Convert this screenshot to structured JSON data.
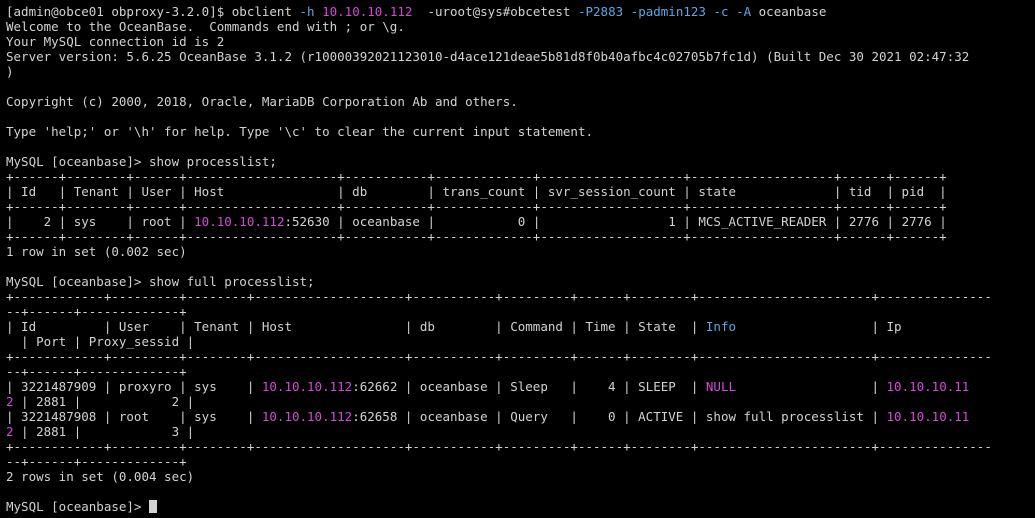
{
  "terminal": {
    "colors": {
      "background": "#000000",
      "default": "#d2d2d2",
      "accent": "#5aa7e6",
      "magenta": "#d24bd6"
    },
    "lines": [
      [
        {
          "t": "[admin@obce01 obproxy-3.2.0]$ obclient "
        },
        {
          "t": "-h",
          "c": "accent"
        },
        {
          "t": " "
        },
        {
          "t": "10.10.10.112",
          "c": "magenta"
        },
        {
          "t": "  -uroot@sys#obcetest "
        },
        {
          "t": "-P2883",
          "c": "accent"
        },
        {
          "t": " "
        },
        {
          "t": "-padmin123",
          "c": "accent"
        },
        {
          "t": " "
        },
        {
          "t": "-c",
          "c": "accent"
        },
        {
          "t": " "
        },
        {
          "t": "-A",
          "c": "accent"
        },
        {
          "t": " oceanbase"
        }
      ],
      [
        {
          "t": "Welcome to the OceanBase.  Commands end with ; or \\g."
        }
      ],
      [
        {
          "t": "Your MySQL connection id is 2"
        }
      ],
      [
        {
          "t": "Server version: 5.6.25 OceanBase 3.1.2 (r10000392021123010-d4ace121deae5b81d8f0b40afbc4c02705b7fc1d) (Built Dec 30 2021 02:47:32"
        }
      ],
      [
        {
          "t": ")"
        }
      ],
      [
        {
          "t": ""
        }
      ],
      [
        {
          "t": "Copyright (c) 2000, 2018, Oracle, MariaDB Corporation Ab and others."
        }
      ],
      [
        {
          "t": ""
        }
      ],
      [
        {
          "t": "Type 'help;' or '\\h' for help. Type '\\c' to clear the current input statement."
        }
      ],
      [
        {
          "t": ""
        }
      ],
      [
        {
          "t": "MySQL [oceanbase]> show processlist;"
        }
      ],
      [
        {
          "t": "+------+--------+------+--------------------+-----------+-------------+-------------------+-------------------+------+------+"
        }
      ],
      [
        {
          "t": "| Id   | Tenant | User | Host               | db        | trans_count | svr_session_count | state             | tid  | pid  |"
        }
      ],
      [
        {
          "t": "+------+--------+------+--------------------+-----------+-------------+-------------------+-------------------+------+------+"
        }
      ],
      [
        {
          "t": "|    2 | sys    | root | "
        },
        {
          "t": "10.10.10.112",
          "c": "magenta"
        },
        {
          "t": ":52630 | oceanbase |           0 |                 1 | MCS_ACTIVE_READER | 2776 | 2776 |"
        }
      ],
      [
        {
          "t": "+------+--------+------+--------------------+-----------+-------------+-------------------+-------------------+------+------+"
        }
      ],
      [
        {
          "t": "1 row in set (0.002 sec)"
        }
      ],
      [
        {
          "t": ""
        }
      ],
      [
        {
          "t": "MySQL [oceanbase]> show full processlist;"
        }
      ],
      [
        {
          "t": "+------------+---------+--------+--------------------+-----------+---------+------+--------+-----------------------+---------------"
        }
      ],
      [
        {
          "t": "--+------+-------------+"
        }
      ],
      [
        {
          "t": "| Id         | User    | Tenant | Host               | db        | Command | Time | State  | "
        },
        {
          "t": "Info",
          "c": "accent"
        },
        {
          "t": "                  | Ip"
        }
      ],
      [
        {
          "t": "  | Port | Proxy_sessid |"
        }
      ],
      [
        {
          "t": "+------------+---------+--------+--------------------+-----------+---------+------+--------+-----------------------+---------------"
        }
      ],
      [
        {
          "t": "--+------+-------------+"
        }
      ],
      [
        {
          "t": "| 3221487909 | proxyro | sys    | "
        },
        {
          "t": "10.10.10.112",
          "c": "magenta"
        },
        {
          "t": ":62662 | oceanbase | Sleep   |    4 | SLEEP  | "
        },
        {
          "t": "NULL",
          "c": "magenta"
        },
        {
          "t": "                  | "
        },
        {
          "t": "10.10.10.11",
          "c": "magenta"
        }
      ],
      [
        {
          "t": "2",
          "c": "magenta"
        },
        {
          "t": " | 2881 |            2 |"
        }
      ],
      [
        {
          "t": "| 3221487908 | root    | sys    | "
        },
        {
          "t": "10.10.10.112",
          "c": "magenta"
        },
        {
          "t": ":62658 | oceanbase | Query   |    0 | ACTIVE | show full processlist | "
        },
        {
          "t": "10.10.10.11",
          "c": "magenta"
        }
      ],
      [
        {
          "t": "2",
          "c": "magenta"
        },
        {
          "t": " | 2881 |            3 |"
        }
      ],
      [
        {
          "t": "+------------+---------+--------+--------------------+-----------+---------+------+--------+-----------------------+---------------"
        }
      ],
      [
        {
          "t": "--+------+-------------+"
        }
      ],
      [
        {
          "t": "2 rows in set (0.004 sec)"
        }
      ],
      [
        {
          "t": ""
        }
      ],
      [
        {
          "t": "MySQL [oceanbase]> "
        }
      ]
    ]
  }
}
